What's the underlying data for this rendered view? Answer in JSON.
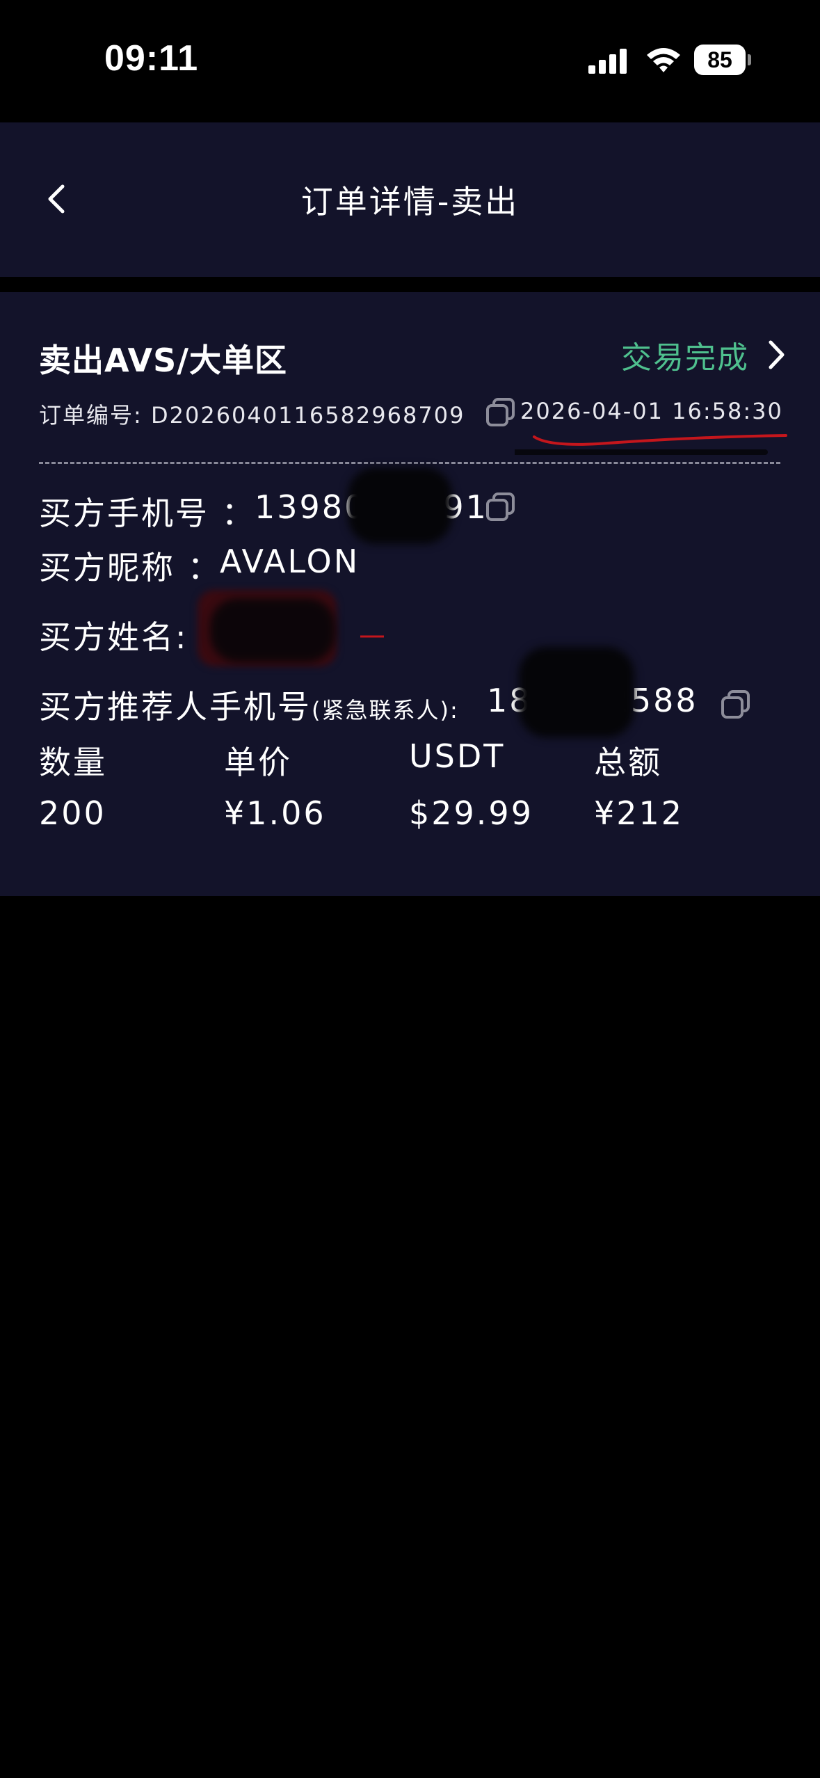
{
  "status_bar": {
    "time": "09:11",
    "battery": "85",
    "icons": [
      "signal-icon",
      "wifi-icon",
      "battery-icon"
    ]
  },
  "header": {
    "title": "订单详情-卖出",
    "back_icon": "chevron-left-icon"
  },
  "order": {
    "type_title": "卖出AVS/大单区",
    "status": "交易完成",
    "status_color": "#4fc08e",
    "order_no_label": "订单编号: ",
    "order_no": "D2026040116582968709",
    "time": "2026-04-01 16:58:30",
    "buyer_phone_label": "买方手机号 ：",
    "buyer_phone": "13980",
    "buyer_phone_tail": "91",
    "buyer_nickname_label": "买方昵称 ：",
    "buyer_nickname": "AVALON",
    "buyer_name_label": "买方姓名:",
    "referrer_label": "买方推荐人手机号",
    "referrer_note": "(紧急联系人):",
    "referrer_phone_head": "18",
    "referrer_phone_tail": "2588"
  },
  "table": {
    "headers": [
      "数量",
      "单价",
      "USDT",
      "总额"
    ],
    "values": [
      "200",
      "¥1.06",
      "$29.99",
      "¥212"
    ]
  },
  "colors": {
    "background": "#000000",
    "panel": "#13132a",
    "accent_green": "#4fc08e",
    "annotation_red": "#c4161c"
  }
}
